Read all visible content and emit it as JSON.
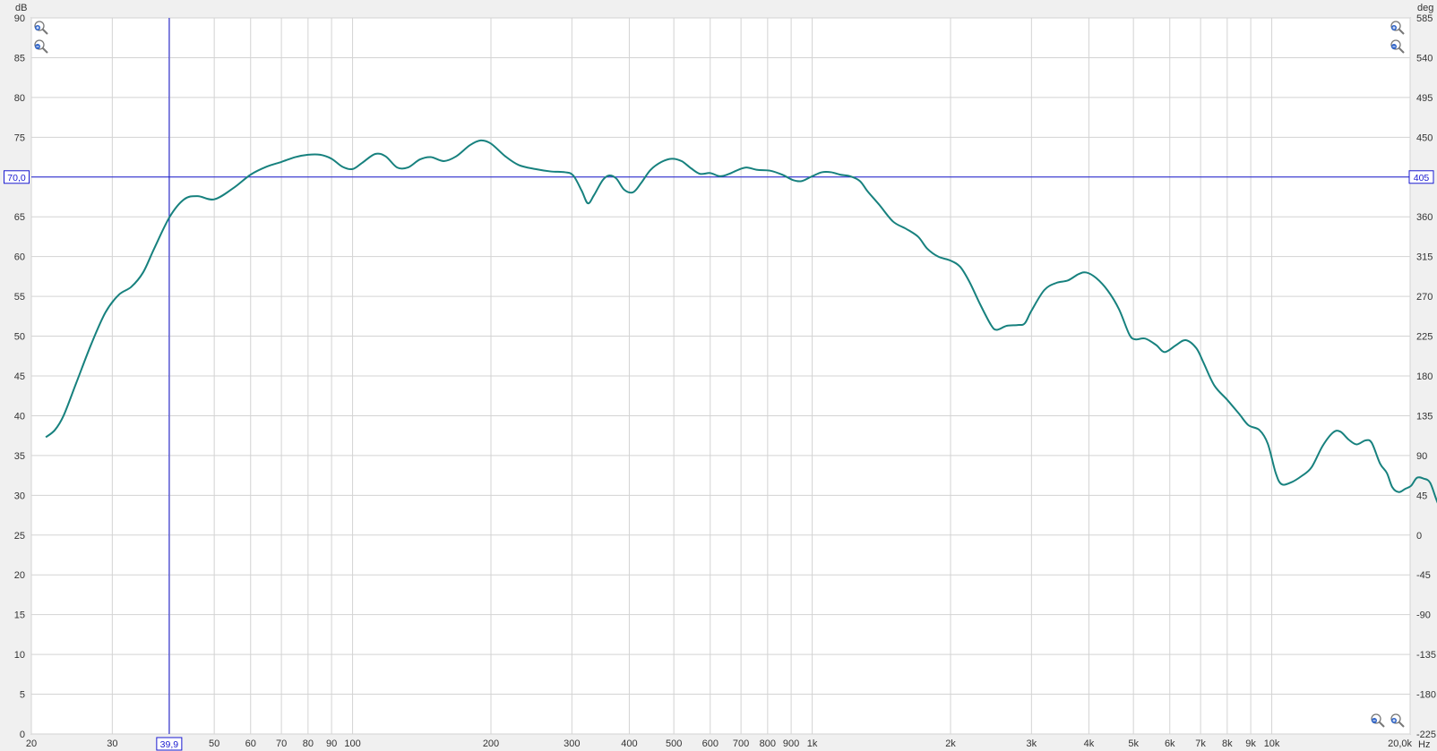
{
  "chart_data": {
    "type": "line",
    "title": "",
    "x_unit": "Hz",
    "y_left_unit": "dB",
    "y_right_unit": "deg",
    "x_scale": "log",
    "xlim": [
      20,
      20000
    ],
    "ylim_left": [
      0,
      90
    ],
    "ylim_right": [
      -225,
      585
    ],
    "grid": true,
    "legend": "none",
    "x_tick_labels": [
      {
        "value": 20,
        "label": "20"
      },
      {
        "value": 30,
        "label": "30"
      },
      {
        "value": 50,
        "label": "50"
      },
      {
        "value": 60,
        "label": "60"
      },
      {
        "value": 70,
        "label": "70"
      },
      {
        "value": 80,
        "label": "80"
      },
      {
        "value": 90,
        "label": "90"
      },
      {
        "value": 100,
        "label": "100"
      },
      {
        "value": 200,
        "label": "200"
      },
      {
        "value": 300,
        "label": "300"
      },
      {
        "value": 400,
        "label": "400"
      },
      {
        "value": 500,
        "label": "500"
      },
      {
        "value": 600,
        "label": "600"
      },
      {
        "value": 700,
        "label": "700"
      },
      {
        "value": 800,
        "label": "800"
      },
      {
        "value": 900,
        "label": "900"
      },
      {
        "value": 1000,
        "label": "1k"
      },
      {
        "value": 2000,
        "label": "2k"
      },
      {
        "value": 3000,
        "label": "3k"
      },
      {
        "value": 4000,
        "label": "4k"
      },
      {
        "value": 5000,
        "label": "5k"
      },
      {
        "value": 6000,
        "label": "6k"
      },
      {
        "value": 7000,
        "label": "7k"
      },
      {
        "value": 8000,
        "label": "8k"
      },
      {
        "value": 9000,
        "label": "9k"
      },
      {
        "value": 10000,
        "label": "10k"
      },
      {
        "value": 20000,
        "label": "20,0k"
      }
    ],
    "y_left_ticks": [
      0,
      5,
      10,
      15,
      20,
      25,
      30,
      35,
      40,
      45,
      50,
      55,
      60,
      65,
      70,
      75,
      80,
      85,
      90
    ],
    "y_right_ticks": [
      -225,
      -180,
      -135,
      -90,
      -45,
      0,
      45,
      90,
      135,
      180,
      225,
      270,
      315,
      360,
      405,
      450,
      495,
      540,
      585
    ],
    "series": [
      {
        "color": "#17817e",
        "points": [
          [
            21.5,
            37.3
          ],
          [
            22.5,
            38.2
          ],
          [
            23.5,
            40.0
          ],
          [
            25,
            44.0
          ],
          [
            27,
            49.0
          ],
          [
            29,
            53.0
          ],
          [
            31,
            55.2
          ],
          [
            33,
            56.2
          ],
          [
            35,
            58.0
          ],
          [
            37,
            61.0
          ],
          [
            40,
            65.0
          ],
          [
            43,
            67.2
          ],
          [
            46,
            67.6
          ],
          [
            50,
            67.2
          ],
          [
            55,
            68.6
          ],
          [
            60,
            70.3
          ],
          [
            65,
            71.3
          ],
          [
            70,
            71.9
          ],
          [
            75,
            72.5
          ],
          [
            80,
            72.8
          ],
          [
            85,
            72.8
          ],
          [
            90,
            72.3
          ],
          [
            95,
            71.3
          ],
          [
            100,
            71.0
          ],
          [
            105,
            71.8
          ],
          [
            112,
            72.9
          ],
          [
            118,
            72.6
          ],
          [
            125,
            71.2
          ],
          [
            132,
            71.2
          ],
          [
            140,
            72.2
          ],
          [
            148,
            72.5
          ],
          [
            158,
            72.0
          ],
          [
            168,
            72.6
          ],
          [
            180,
            74.0
          ],
          [
            190,
            74.6
          ],
          [
            200,
            74.2
          ],
          [
            215,
            72.6
          ],
          [
            230,
            71.5
          ],
          [
            250,
            71.0
          ],
          [
            270,
            70.7
          ],
          [
            290,
            70.6
          ],
          [
            302,
            70.2
          ],
          [
            315,
            68.3
          ],
          [
            325,
            66.7
          ],
          [
            335,
            67.7
          ],
          [
            350,
            69.6
          ],
          [
            362,
            70.2
          ],
          [
            375,
            69.8
          ],
          [
            390,
            68.4
          ],
          [
            408,
            68.1
          ],
          [
            425,
            69.3
          ],
          [
            445,
            70.9
          ],
          [
            470,
            71.9
          ],
          [
            495,
            72.3
          ],
          [
            520,
            72.0
          ],
          [
            545,
            71.1
          ],
          [
            570,
            70.4
          ],
          [
            600,
            70.5
          ],
          [
            630,
            70.1
          ],
          [
            660,
            70.4
          ],
          [
            690,
            70.9
          ],
          [
            720,
            71.2
          ],
          [
            760,
            70.9
          ],
          [
            810,
            70.8
          ],
          [
            860,
            70.3
          ],
          [
            910,
            69.6
          ],
          [
            950,
            69.5
          ],
          [
            1000,
            70.1
          ],
          [
            1050,
            70.6
          ],
          [
            1100,
            70.6
          ],
          [
            1150,
            70.3
          ],
          [
            1210,
            70.1
          ],
          [
            1270,
            69.5
          ],
          [
            1320,
            68.2
          ],
          [
            1400,
            66.5
          ],
          [
            1500,
            64.4
          ],
          [
            1600,
            63.5
          ],
          [
            1700,
            62.5
          ],
          [
            1780,
            61.0
          ],
          [
            1880,
            60.0
          ],
          [
            2000,
            59.5
          ],
          [
            2100,
            58.7
          ],
          [
            2200,
            56.8
          ],
          [
            2320,
            54.0
          ],
          [
            2450,
            51.4
          ],
          [
            2520,
            50.8
          ],
          [
            2650,
            51.3
          ],
          [
            2800,
            51.4
          ],
          [
            2900,
            51.6
          ],
          [
            3000,
            53.2
          ],
          [
            3200,
            55.8
          ],
          [
            3400,
            56.7
          ],
          [
            3600,
            57.0
          ],
          [
            3800,
            57.8
          ],
          [
            3950,
            58.0
          ],
          [
            4150,
            57.3
          ],
          [
            4400,
            55.7
          ],
          [
            4650,
            53.4
          ],
          [
            4900,
            50.2
          ],
          [
            5050,
            49.6
          ],
          [
            5300,
            49.7
          ],
          [
            5600,
            48.9
          ],
          [
            5850,
            48.0
          ],
          [
            6200,
            48.9
          ],
          [
            6500,
            49.5
          ],
          [
            6850,
            48.5
          ],
          [
            7100,
            46.7
          ],
          [
            7500,
            43.8
          ],
          [
            8000,
            42.0
          ],
          [
            8500,
            40.2
          ],
          [
            8900,
            38.8
          ],
          [
            9400,
            38.2
          ],
          [
            9800,
            36.5
          ],
          [
            10200,
            32.8
          ],
          [
            10500,
            31.4
          ],
          [
            11000,
            31.6
          ],
          [
            11600,
            32.4
          ],
          [
            12200,
            33.5
          ],
          [
            12900,
            36.2
          ],
          [
            13600,
            37.9
          ],
          [
            14100,
            38.0
          ],
          [
            14700,
            37.0
          ],
          [
            15300,
            36.4
          ],
          [
            16000,
            36.9
          ],
          [
            16500,
            36.6
          ],
          [
            17200,
            34.0
          ],
          [
            17800,
            32.8
          ],
          [
            18300,
            31.0
          ],
          [
            18900,
            30.4
          ],
          [
            19500,
            30.8
          ],
          [
            20100,
            31.2
          ],
          [
            20700,
            32.2
          ],
          [
            21400,
            32.1
          ],
          [
            22100,
            31.6
          ],
          [
            22800,
            29.5
          ],
          [
            23800,
            26.8
          ],
          [
            24300,
            25.2
          ],
          [
            24700,
            24.8
          ]
        ]
      }
    ],
    "cursor": {
      "x_value": 39.9,
      "x_label": "39,9",
      "y_value": 70.0,
      "y_label_left": "70,0",
      "y_label_right": "405"
    },
    "colors": {
      "background": "#f0f0f0",
      "plot_area": "#ffffff",
      "grid": "#d3d3d3",
      "cursor": "#1a1ad0",
      "curve": "#17817e"
    },
    "icons": [
      "zoom-in-icon",
      "zoom-out-icon"
    ]
  }
}
